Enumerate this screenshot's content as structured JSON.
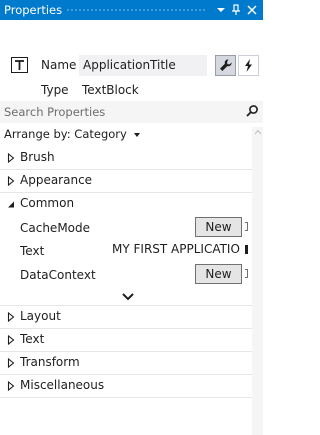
{
  "window": {
    "title": "Properties",
    "buttons": [
      "dropdown",
      "pin",
      "close"
    ]
  },
  "header": {
    "name_label": "Name",
    "name_value": "ApplicationTitle",
    "type_label": "Type",
    "type_value": "TextBlock",
    "icons": {
      "type_icon": "text-block-icon",
      "properties_tool": "wrench-icon",
      "events_tool": "lightning-icon"
    }
  },
  "search": {
    "placeholder": "Search Properties",
    "icon": "search-icon"
  },
  "arrange": {
    "label": "Arrange by: Category",
    "icon": "caret-down-icon"
  },
  "categories": {
    "brush": "Brush",
    "appearance": "Appearance",
    "common": "Common",
    "layout": "Layout",
    "text": "Text",
    "transform": "Transform",
    "miscellaneous": "Miscellaneous"
  },
  "common_properties": [
    {
      "label": "CacheMode",
      "editor": "button",
      "value": "New"
    },
    {
      "label": "Text",
      "editor": "textbox",
      "value": "MY FIRST APPLICATION"
    },
    {
      "label": "DataContext",
      "editor": "button",
      "value": "New"
    }
  ],
  "show_more_icon": "chevron-down-icon",
  "colors": {
    "accent": "#007acc",
    "search_bg": "#f5f5f5",
    "input_bg": "#f1f1f4",
    "button_bg": "#e5e5e5",
    "text": "#1e1e1e"
  }
}
